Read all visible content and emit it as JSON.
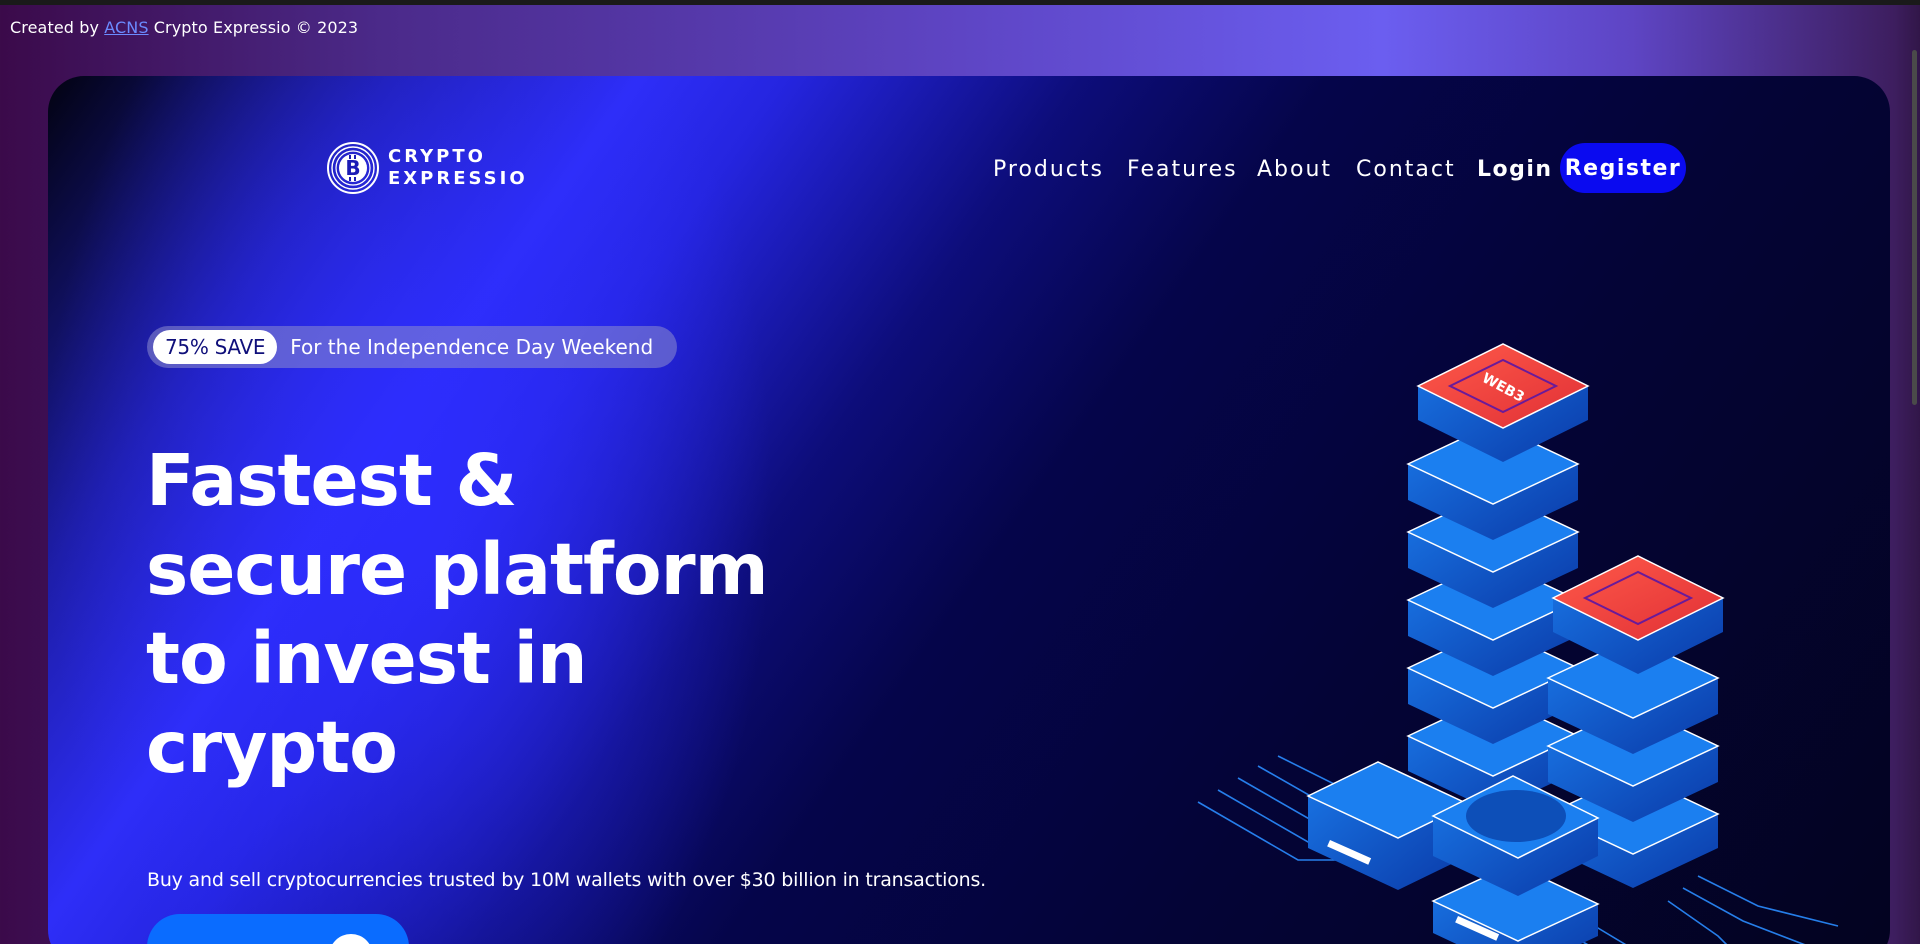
{
  "credit": {
    "prefix": "Created by",
    "link": "ACNS",
    "suffix": "Crypto Expressio © 2023"
  },
  "brand": {
    "line1": "CRYPTO",
    "line2": "EXPRESSIO",
    "icon": "bitcoin-logo-icon"
  },
  "nav": {
    "items": [
      "Products",
      "Features",
      "About",
      "Contact"
    ],
    "login": "Login",
    "register": "Register"
  },
  "promo": {
    "badge": "75% SAVE",
    "text": "For the Independence Day Weekend"
  },
  "hero": {
    "headline_lines": [
      "Fastest &",
      "secure platform",
      "to invest in",
      "crypto"
    ],
    "subtext": "Buy and sell cryptocurrencies trusted by 10M wallets with over $30 billion in transactions."
  },
  "illustration": {
    "label": "WEB3",
    "icon": "server-stack-illustration"
  },
  "colors": {
    "accent": "#0a0af0",
    "cta": "#0a6cff",
    "server_top": "#f0453f",
    "server_blue": "#1166d8"
  }
}
